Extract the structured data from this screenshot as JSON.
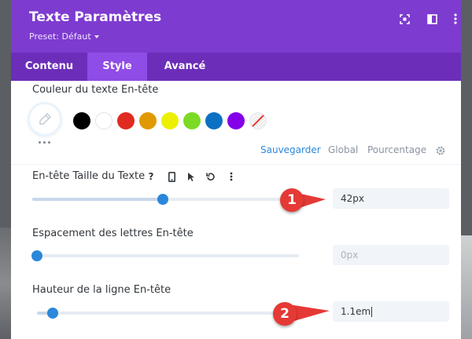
{
  "header": {
    "title": "Texte Paramètres",
    "preset": "Preset: Défaut",
    "icons": [
      "focus-icon",
      "sidebar-icon",
      "more-vertical-icon"
    ]
  },
  "tabs": [
    {
      "label": "Contenu",
      "active": false
    },
    {
      "label": "Style",
      "active": true
    },
    {
      "label": "Avancé",
      "active": false
    }
  ],
  "text_color": {
    "label": "Couleur du texte En-tête",
    "swatches": [
      "#000000",
      "#ffffff",
      "#e02b20",
      "#e09900",
      "#edf000",
      "#7cda24",
      "#0c71c3",
      "#8300e9"
    ],
    "palette_options": [
      "Sauvegarder",
      "Global",
      "Pourcentage"
    ],
    "active_option": "Sauvegarder"
  },
  "heading_text_size": {
    "label": "En-tête Taille du Texte",
    "value": "42px",
    "slider_fraction": 0.51,
    "icons": [
      "help-icon",
      "mobile-icon",
      "cursor-icon",
      "reset-icon",
      "more-icon"
    ],
    "help_glyph": "?"
  },
  "letter_spacing": {
    "label": "Espacement des lettres En-tête",
    "placeholder": "0px",
    "slider_fraction": 0.0
  },
  "line_height": {
    "label": "Hauteur de la ligne En-tête",
    "value": "1.1em",
    "slider_fraction": 0.06
  },
  "annotations": [
    "1",
    "2"
  ],
  "colors": {
    "header": "#7e3bd0",
    "tabs": "#6c2eb9",
    "active_tab": "#8f4ce6",
    "accent": "#2b87da",
    "annotation": "#e53935"
  }
}
